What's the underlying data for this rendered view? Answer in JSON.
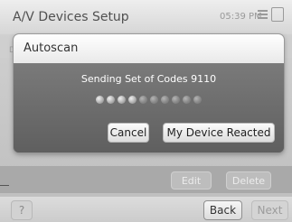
{
  "window": {
    "title": "A/V Devices Setup",
    "clock": "05:39 PM"
  },
  "background": {
    "list_first_char": "D",
    "list_right_char": "e",
    "edit_label": "Edit",
    "delete_label": "Delete"
  },
  "footer": {
    "help_label": "?",
    "back_label": "Back",
    "next_label": "Next"
  },
  "dialog": {
    "title": "Autoscan",
    "message": "Sending Set of Codes 9110",
    "progress": {
      "total_dots": 10,
      "lit_dots": 4
    },
    "cancel_label": "Cancel",
    "reacted_label": "My Device Reacted"
  },
  "icons": [
    "status-bars-icon",
    "tray-icon",
    "progress-dot-icon"
  ],
  "colors": {
    "dialog_body": "#6e6e6e",
    "dialog_header": "#f4f4f4",
    "topbar": "#e2e2e2",
    "button_face": "#f2f2f2"
  }
}
